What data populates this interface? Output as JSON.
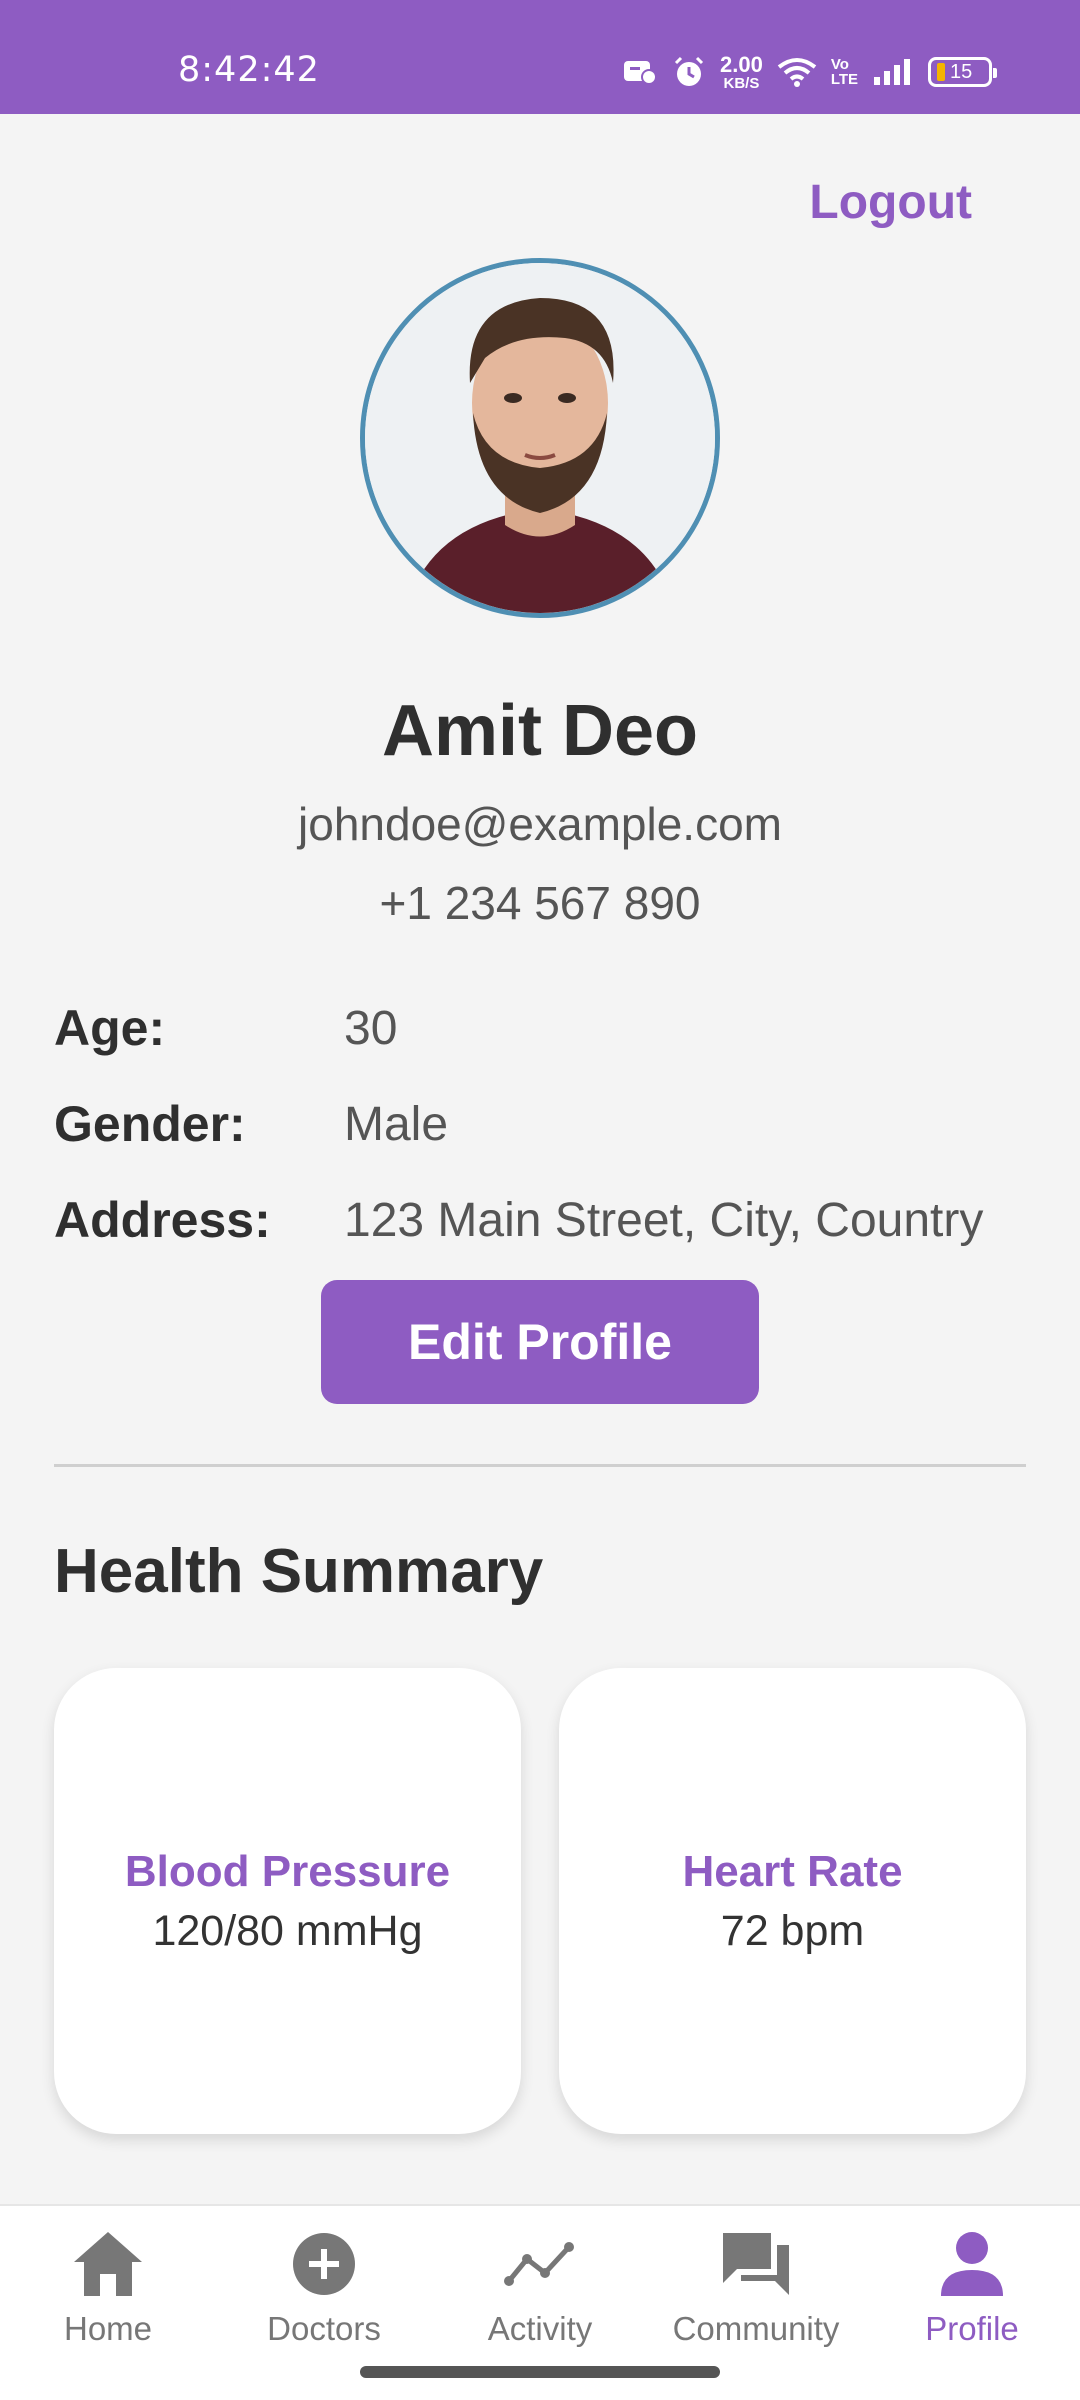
{
  "status_bar": {
    "time": "8:42:42",
    "net_speed_value": "2.00",
    "net_speed_unit": "KB/S",
    "volte_top": "Vo",
    "volte_bottom": "LTE",
    "battery": "15"
  },
  "header": {
    "logout_label": "Logout"
  },
  "profile": {
    "name": "Amit Deo",
    "email": "johndoe@example.com",
    "phone": "+1 234 567 890",
    "details": [
      {
        "label": "Age:",
        "value": "30"
      },
      {
        "label": "Gender:",
        "value": "Male"
      },
      {
        "label": "Address:",
        "value": "123 Main Street, City, Country"
      }
    ],
    "edit_label": "Edit Profile"
  },
  "health_summary": {
    "title": "Health Summary",
    "cards": [
      {
        "title": "Blood Pressure",
        "value": "120/80 mmHg"
      },
      {
        "title": "Heart Rate",
        "value": "72 bpm"
      }
    ]
  },
  "bottom_nav": {
    "items": [
      {
        "label": "Home",
        "icon": "home-icon"
      },
      {
        "label": "Doctors",
        "icon": "plus-circle-icon"
      },
      {
        "label": "Activity",
        "icon": "activity-icon"
      },
      {
        "label": "Community",
        "icon": "chat-icon"
      },
      {
        "label": "Profile",
        "icon": "person-icon"
      }
    ],
    "active": "Profile"
  },
  "colors": {
    "accent": "#8e5cc2",
    "avatar_border": "#4f8fb3",
    "background": "#f4f4f4"
  }
}
